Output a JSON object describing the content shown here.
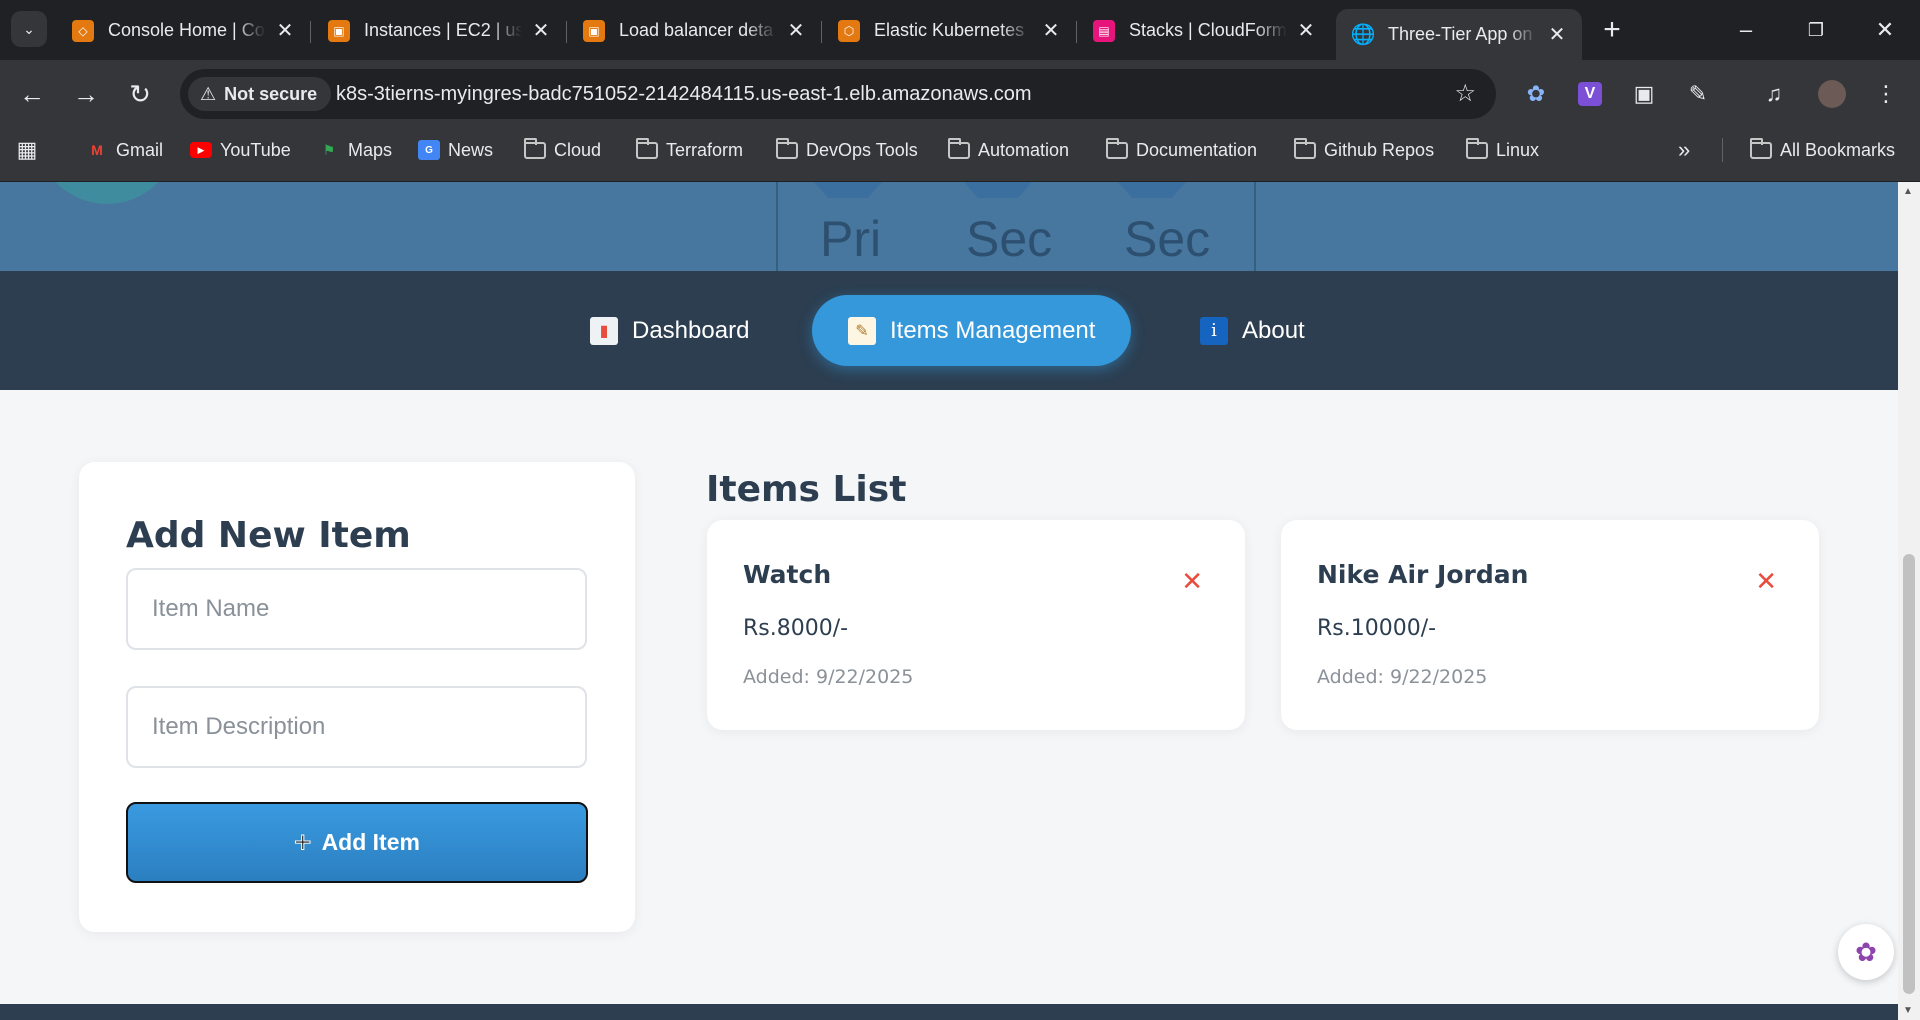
{
  "browser": {
    "tabs": [
      {
        "title": "Console Home | Co",
        "icon": "aws-console-icon",
        "color": "#e47911"
      },
      {
        "title": "Instances | EC2 | us",
        "icon": "ec2-icon",
        "color": "#e47911"
      },
      {
        "title": "Load balancer deta",
        "icon": "ec2-icon",
        "color": "#e47911"
      },
      {
        "title": "Elastic Kubernetes",
        "icon": "eks-icon",
        "color": "#e47911"
      },
      {
        "title": "Stacks | CloudForm",
        "icon": "cloudformation-icon",
        "color": "#e7157b"
      },
      {
        "title": "Three-Tier App on",
        "icon": "globe-icon",
        "color": "#9aa0a6",
        "active": true
      }
    ],
    "security_label": "Not secure",
    "url": "k8s-3tierns-myingres-badc751052-2142484115.us-east-1.elb.amazonaws.com",
    "bookmarks": [
      {
        "label": "Gmail",
        "type": "gmail"
      },
      {
        "label": "YouTube",
        "type": "youtube"
      },
      {
        "label": "Maps",
        "type": "maps"
      },
      {
        "label": "News",
        "type": "news"
      },
      {
        "label": "Cloud",
        "type": "folder"
      },
      {
        "label": "Terraform",
        "type": "folder"
      },
      {
        "label": "DevOps Tools",
        "type": "folder"
      },
      {
        "label": "Automation",
        "type": "folder"
      },
      {
        "label": "Documentation",
        "type": "folder"
      },
      {
        "label": "Github Repos",
        "type": "folder"
      },
      {
        "label": "Linux",
        "type": "folder"
      }
    ],
    "all_bookmarks": "All Bookmarks"
  },
  "hero": {
    "labels": [
      "Pri",
      "Sec",
      "Sec"
    ]
  },
  "nav": {
    "items": [
      {
        "label": "Dashboard",
        "icon": "chart-icon"
      },
      {
        "label": "Items Management",
        "icon": "memo-icon",
        "active": true
      },
      {
        "label": "About",
        "icon": "info-icon"
      }
    ]
  },
  "form": {
    "title": "Add New Item",
    "name_placeholder": "Item Name",
    "description_placeholder": "Item Description",
    "submit_label": "Add Item"
  },
  "items_list": {
    "title": "Items List",
    "items": [
      {
        "name": "Watch",
        "price": "Rs.8000/-",
        "added": "Added: 9/22/2025"
      },
      {
        "name": "Nike Air Jordan",
        "price": "Rs.10000/-",
        "added": "Added: 9/22/2025"
      }
    ]
  },
  "colors": {
    "navbar_bg": "#2c3e50",
    "accent": "#3498db",
    "delete": "#e74c3c",
    "text_dark": "#2c3e50",
    "text_muted": "#8a9199"
  }
}
